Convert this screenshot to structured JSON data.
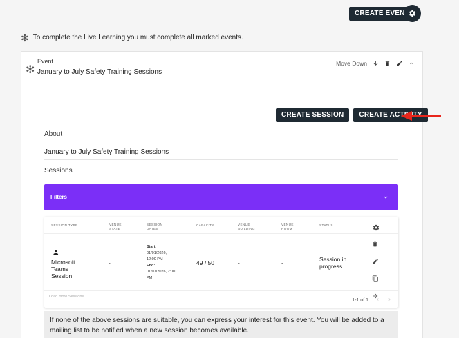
{
  "header": {
    "create_event_label": "CREATE EVENT"
  },
  "notice": {
    "text": "To complete the Live Learning you must complete all marked events."
  },
  "event": {
    "label": "Event",
    "title": "January to July Safety Training Sessions",
    "move_down_label": "Move Down"
  },
  "actions": {
    "create_session_label": "CREATE SESSION",
    "create_activity_label": "CREATE ACTIVITY"
  },
  "about": {
    "label": "About",
    "text": "January to July Safety Training Sessions"
  },
  "sessions": {
    "label": "Sessions",
    "filters_label": "Filters",
    "columns": [
      "SESSION TYPE",
      "VENUE STATE",
      "SESSION DATES",
      "CAPACITY",
      "VENUE BUILDING",
      "VENUE ROOM",
      "STATUS"
    ],
    "row": {
      "type": "Microsoft Teams Session",
      "venue_state": "-",
      "start_label": "Start:",
      "start": "01/01/2026, 12:00 PM",
      "end_label": "End:",
      "end": "01/07/2026, 2:00 PM",
      "capacity": "49 / 50",
      "venue_building": "-",
      "venue_room": "-",
      "status": "Session in progress"
    },
    "load_more": "Load more Sessions",
    "pagination": "1-1 of 1"
  },
  "info": {
    "text": "If none of the above sessions are suitable, you can express your interest for this event. You will be added to a mailing list to be notified when a new session becomes available."
  },
  "colors": {
    "primary_dark": "#1f2a33",
    "filters_purple": "#7b2ff7",
    "annotation_red": "#e8261c"
  }
}
